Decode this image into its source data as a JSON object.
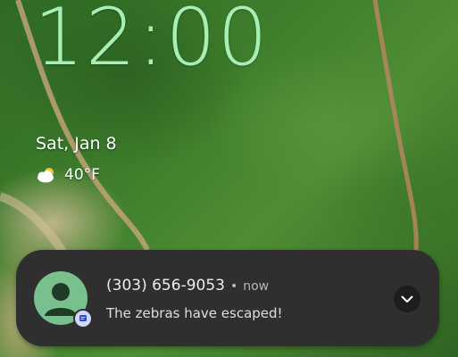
{
  "lock_screen": {
    "time": "12:00",
    "date": "Sat, Jan 8",
    "weather": {
      "icon": "partly-cloudy-icon",
      "temperature": "40°F"
    },
    "colors": {
      "clock": "#a6f0b6"
    }
  },
  "notification": {
    "sender": "(303) 656-9053",
    "separator": "•",
    "timestamp": "now",
    "message": "The zebras have escaped!",
    "avatar_icon": "person-icon",
    "app_badge_icon": "messages-icon",
    "expand_icon": "chevron-down-icon",
    "colors": {
      "card": "#2f2f30",
      "avatar": "#78c08d",
      "badge": "#cfd9ff"
    }
  }
}
